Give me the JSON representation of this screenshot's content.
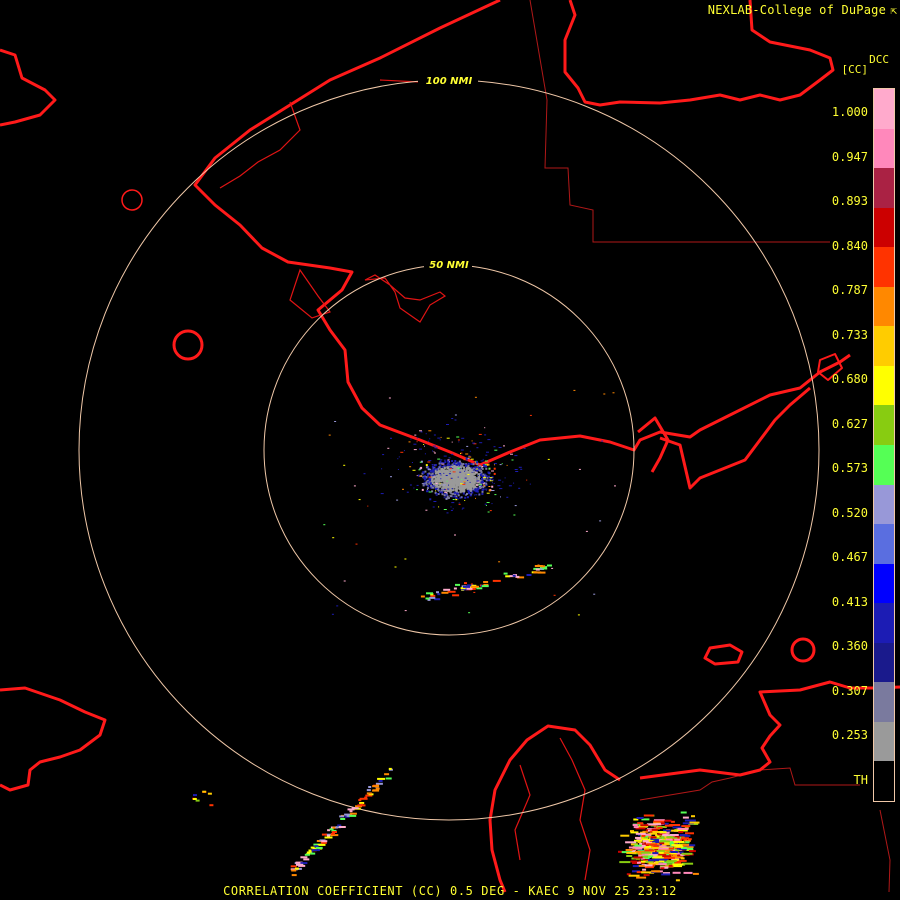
{
  "header": {
    "credit": "NEXLAB-College of DuPage",
    "credit_icon": "external-link-icon"
  },
  "legend": {
    "product_code": "DCC",
    "unit": "[CC]",
    "ticks": [
      "1.000",
      "0.947",
      "0.893",
      "0.840",
      "0.787",
      "0.733",
      "0.680",
      "0.627",
      "0.573",
      "0.520",
      "0.467",
      "0.413",
      "0.360",
      "0.307",
      "0.253",
      "TH"
    ],
    "colors": [
      "#000000",
      "#9a9a9a",
      "#7a7a9e",
      "#1a1a8c",
      "#1c1cb4",
      "#0000ff",
      "#5a6ee0",
      "#9898d8",
      "#55ff55",
      "#88cc11",
      "#ffff00",
      "#ffcc00",
      "#ff8800",
      "#ff3300",
      "#cc0000",
      "#aa2244",
      "#ff88bb",
      "#ffaacc"
    ]
  },
  "map": {
    "range_rings": [
      {
        "label": "50 NMI",
        "range": 50
      },
      {
        "label": "100 NMI",
        "range": 100
      }
    ]
  },
  "footer": {
    "caption": "CORRELATION COEFFICIENT (CC) 0.5 DEG - KAEC 9 NOV 25 23:12"
  }
}
